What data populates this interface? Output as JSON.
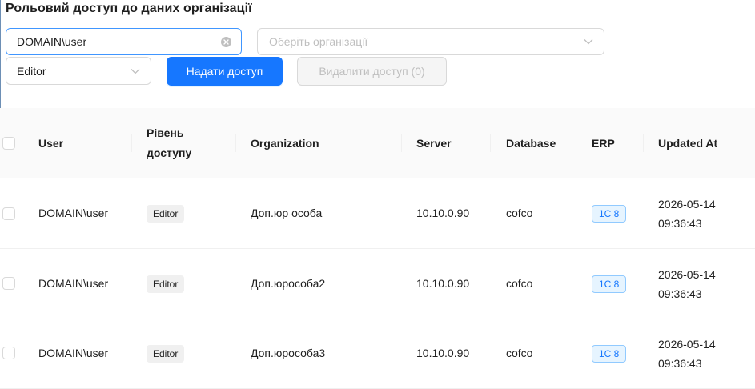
{
  "page": {
    "title": "Рольовий доступ до даних організації"
  },
  "filters": {
    "user_value": "DOMAIN\\user",
    "org_placeholder": "Оберіть організації",
    "role_value": "Editor"
  },
  "actions": {
    "grant_label": "Надати доступ",
    "remove_label": "Видалити доступ (0)"
  },
  "table": {
    "headers": {
      "user": "User",
      "level_line1": "Рівень",
      "level_line2": "доступу",
      "organization": "Organization",
      "server": "Server",
      "database": "Database",
      "erp": "ERP",
      "updated_at": "Updated At"
    },
    "rows": [
      {
        "user": "DOMAIN\\user",
        "level": "Editor",
        "organization": "Доп.юр особа",
        "server": "10.10.0.90",
        "database": "cofco",
        "erp": "1С 8",
        "updated_date": "2026-05-14",
        "updated_time": "09:36:43"
      },
      {
        "user": "DOMAIN\\user",
        "level": "Editor",
        "organization": "Доп.юрособа2",
        "server": "10.10.0.90",
        "database": "cofco",
        "erp": "1С 8",
        "updated_date": "2026-05-14",
        "updated_time": "09:36:43"
      },
      {
        "user": "DOMAIN\\user",
        "level": "Editor",
        "organization": "Доп.юрособа3",
        "server": "10.10.0.90",
        "database": "cofco",
        "erp": "1С 8",
        "updated_date": "2026-05-14",
        "updated_time": "09:36:43"
      }
    ]
  },
  "colors": {
    "primary": "#1677ff",
    "erp_tag_bg": "#e6f4ff",
    "header_bg": "#fafafa"
  },
  "icons": {
    "clear": "close-circle-icon",
    "dropdown": "chevron-down-icon",
    "checkbox": "checkbox"
  }
}
